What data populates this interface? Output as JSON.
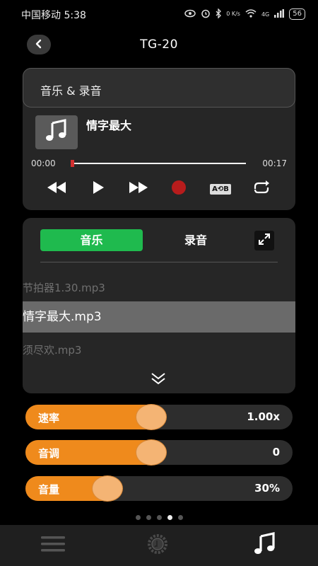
{
  "status": {
    "carrier_time": "中国移动 5:38",
    "net_speed": "0 K/s",
    "signal": "4G",
    "battery": "56"
  },
  "header": {
    "title": "TG-20"
  },
  "player": {
    "section_title": "音乐 & 录音",
    "song_name": "情字最大",
    "time_current": "00:00",
    "time_total": "00:17",
    "progress": 0.0,
    "ab_label": "A⟲B"
  },
  "playlist": {
    "tab_music": "音乐",
    "tab_record": "录音",
    "files": [
      "节拍器1.30.mp3",
      "情字最大.mp3",
      "须尽欢.mp3"
    ],
    "active_index": 1
  },
  "sliders": [
    {
      "label": "速率",
      "value": "1.00x",
      "level": 0.5
    },
    {
      "label": "音调",
      "value": "0",
      "level": 0.5
    },
    {
      "label": "音量",
      "value": "30%",
      "level": 0.3
    }
  ],
  "pager": {
    "count": 5,
    "active": 3
  },
  "colors": {
    "accent_green": "#1fba4e",
    "accent_orange": "#ef8a1c",
    "record_red": "#b71c1c"
  }
}
